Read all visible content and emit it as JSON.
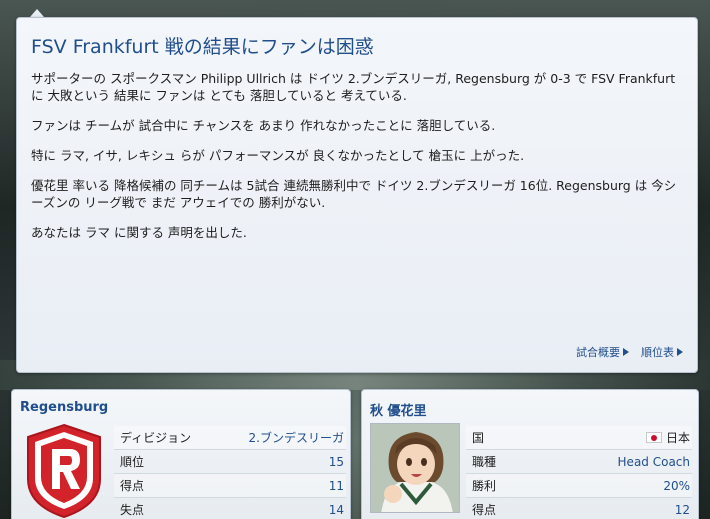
{
  "message": {
    "title": "FSV Frankfurt 戦の結果にファンは困惑",
    "paragraphs": [
      "サポーターの スポークスマン Philipp Ullrich は ドイツ 2.ブンデスリーガ, Regensburg が 0-3 で FSV Frankfurt に 大敗という 結果に ファンは とても 落胆していると 考えている.",
      "ファンは チームが 試合中に チャンスを あまり 作れなかったことに 落胆している.",
      "特に ラマ, イサ, レキシュ らが パフォーマンスが 良くなかったとして 槍玉に 上がった.",
      "優花里 率いる 降格候補の 同チームは 5試合 連続無勝利中で ドイツ 2.ブンデスリーガ 16位. Regensburg は 今シーズンの リーグ戦で まだ アウェイでの 勝利がない.",
      "あなたは ラマ に関する 声明を出した."
    ],
    "links": {
      "match_summary": "試合概要",
      "table": "順位表"
    }
  },
  "club": {
    "name": "Regensburg",
    "stats": [
      {
        "label": "ディビジョン",
        "value": "2.ブンデスリーガ"
      },
      {
        "label": "順位",
        "value": "15"
      },
      {
        "label": "得点",
        "value": "11"
      },
      {
        "label": "失点",
        "value": "14"
      }
    ]
  },
  "manager": {
    "name": "秋 優花里",
    "stats": [
      {
        "label": "国",
        "value": "日本"
      },
      {
        "label": "職種",
        "value": "Head Coach"
      },
      {
        "label": "勝利",
        "value": "20%"
      },
      {
        "label": "得点",
        "value": "12"
      }
    ]
  },
  "colors": {
    "accent": "#214f8d",
    "crest_red": "#d2232a"
  }
}
